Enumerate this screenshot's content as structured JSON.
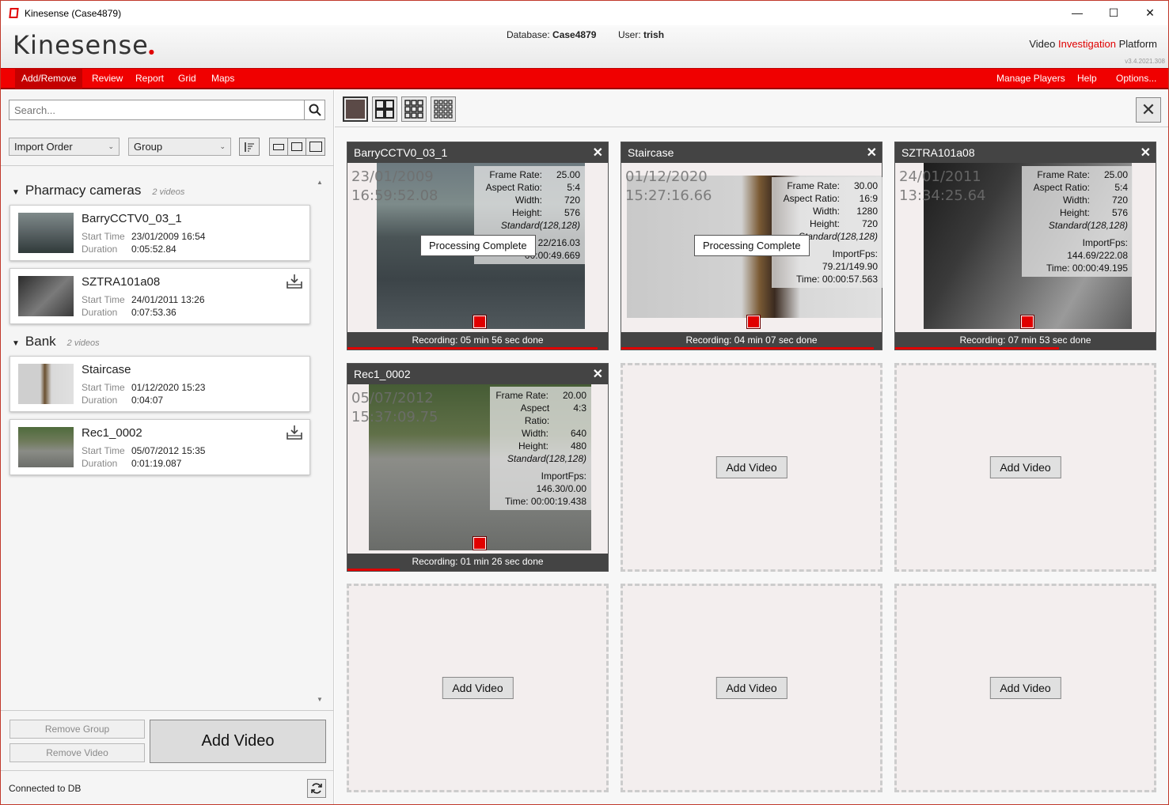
{
  "window": {
    "title": "Kinesense (Case4879)",
    "minimize": "—",
    "maximize": "☐",
    "close": "✕"
  },
  "header": {
    "logo": "Kinesense",
    "database_label": "Database:",
    "database": "Case4879",
    "user_label": "User:",
    "user": "trish",
    "platform_prefix": "Video ",
    "platform_red": "Investigation",
    "platform_suffix": " Platform",
    "version": "v3.4.2021.308"
  },
  "menu": {
    "left": [
      "Add/Remove",
      "Review",
      "Report",
      "Grid",
      "Maps"
    ],
    "right": [
      "Manage Players",
      "Help",
      "Options..."
    ]
  },
  "sidebar": {
    "search_placeholder": "Search...",
    "sort_select": "Import Order",
    "group_select": "Group",
    "groups": [
      {
        "name": "Pharmacy cameras",
        "count": "2  videos"
      },
      {
        "name": "Bank",
        "count": "2  videos"
      }
    ],
    "videos": [
      {
        "name": "BarryCCTV0_03_1",
        "start_label": "Start Time",
        "start": "23/01/2009 16:54",
        "duration_label": "Duration",
        "duration": "0:05:52.84"
      },
      {
        "name": "SZTRA101a08",
        "start_label": "Start Time",
        "start": "24/01/2011 13:26",
        "duration_label": "Duration",
        "duration": "0:07:53.36"
      },
      {
        "name": "Staircase",
        "start_label": "Start Time",
        "start": "01/12/2020 15:23",
        "duration_label": "Duration",
        "duration": "0:04:07"
      },
      {
        "name": "Rec1_0002",
        "start_label": "Start Time",
        "start": "05/07/2012 15:35",
        "duration_label": "Duration",
        "duration": "0:01:19.087"
      }
    ],
    "remove_group": "Remove Group",
    "remove_video": "Remove Video",
    "add_video": "Add Video",
    "status": "Connected to DB"
  },
  "players": [
    {
      "title": "BarryCCTV0_03_1",
      "date": "23/01/2009",
      "time": "16:59:52.08",
      "frame_rate": "25.00",
      "aspect": "5:4",
      "width": "720",
      "height": "576",
      "standard": "Standard(128,128)",
      "import_fps": "22/216.03",
      "elapsed": "00:00:49.669",
      "processing": "Processing Complete",
      "recording": "Recording: 05 min 56 sec  done",
      "progress": 0.96
    },
    {
      "title": "Staircase",
      "date": "01/12/2020",
      "time": "15:27:16.66",
      "frame_rate": "30.00",
      "aspect": "16:9",
      "width": "1280",
      "height": "720",
      "standard": "Standard(128,128)",
      "import_fps": "ImportFps: 79.21/149.90",
      "elapsed": "Time: 00:00:57.563",
      "processing": "Processing Complete",
      "recording": "Recording: 04 min 07 sec  done",
      "progress": 0.97
    },
    {
      "title": "SZTRA101a08",
      "date": "24/01/2011",
      "time": "13:34:25.64",
      "frame_rate": "25.00",
      "aspect": "5:4",
      "width": "720",
      "height": "576",
      "standard": "Standard(128,128)",
      "import_fps": "ImportFps: 144.69/222.08",
      "elapsed": "Time: 00:00:49.195",
      "recording": "Recording: 07 min 53 sec  done",
      "progress": 0.63
    },
    {
      "title": "Rec1_0002",
      "date": "05/07/2012",
      "time": "15:37:09.75",
      "frame_rate": "20.00",
      "aspect": "4:3",
      "width": "640",
      "height": "480",
      "standard": "Standard(128,128)",
      "import_fps": "ImportFps: 146.30/0.00",
      "elapsed": "Time: 00:00:19.438",
      "recording": "Recording: 01 min 26 sec  done",
      "progress": 0.2
    }
  ],
  "labels": {
    "frame_rate": "Frame Rate:",
    "aspect": "Aspect Ratio:",
    "width": "Width:",
    "height": "Height:"
  },
  "empty_slot_label": "Add Video",
  "colors": {
    "accent": "#f00000",
    "dark": "#444444"
  }
}
